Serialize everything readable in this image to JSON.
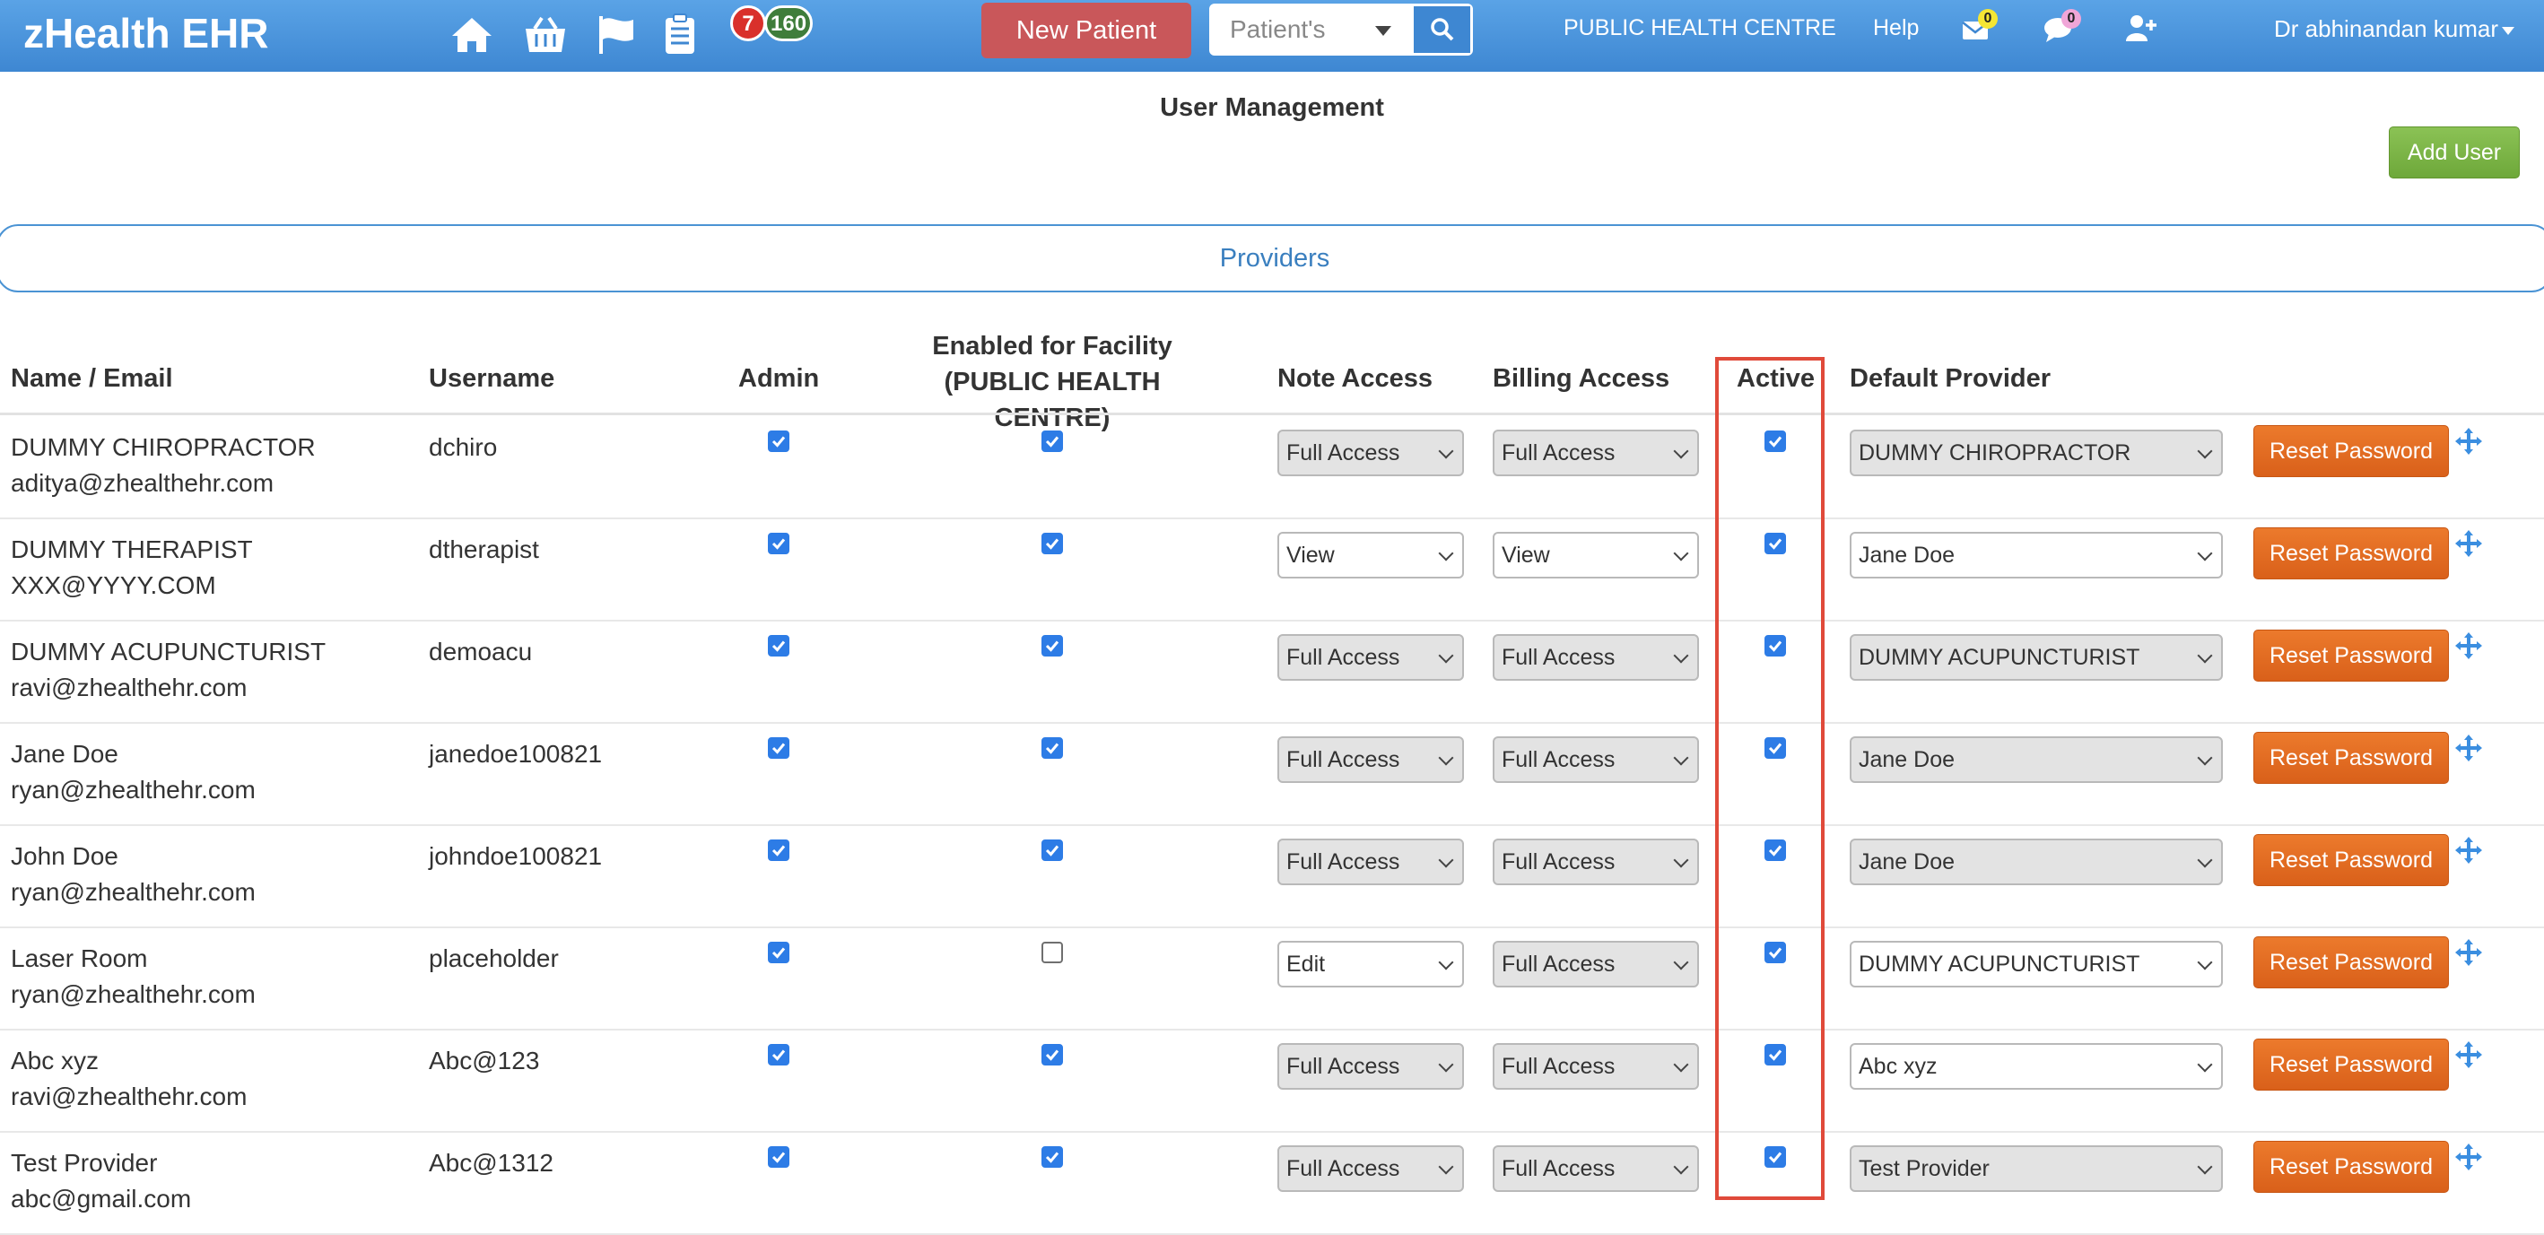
{
  "navbar": {
    "brand": "zHealth EHR",
    "icons": [
      "home-icon",
      "basket-icon",
      "flag-icon",
      "clipboard-icon"
    ],
    "badge_red": "7",
    "badge_green": "160",
    "new_patient_label": "New Patient",
    "search_select_value": "Patient's",
    "facility": "PUBLIC HEALTH CENTRE",
    "help": "Help",
    "mail_count": "0",
    "chat_count": "0",
    "user_name": "Dr abhinandan kumar"
  },
  "page": {
    "title": "User Management",
    "add_user_label": "Add User",
    "tab_label": "Providers"
  },
  "table": {
    "headers": {
      "name": "Name / Email",
      "username": "Username",
      "admin": "Admin",
      "facility_line1": "Enabled for Facility",
      "facility_line2": "(PUBLIC HEALTH CENTRE)",
      "note": "Note Access",
      "billing": "Billing Access",
      "active": "Active",
      "default_provider": "Default Provider"
    },
    "reset_label": "Reset Password",
    "rows": [
      {
        "name": "DUMMY CHIROPRACTOR",
        "email": "aditya@zhealthehr.com",
        "username": "dchiro",
        "admin": true,
        "facility": true,
        "note": "Full Access",
        "billing": "Full Access",
        "active": true,
        "provider": "DUMMY CHIROPRACTOR"
      },
      {
        "name": "DUMMY THERAPIST",
        "email": "XXX@YYYY.COM",
        "username": "dtherapist",
        "admin": true,
        "facility": true,
        "note": "View",
        "billing": "View",
        "active": true,
        "provider": "Jane Doe"
      },
      {
        "name": "DUMMY ACUPUNCTURIST",
        "email": "ravi@zhealthehr.com",
        "username": "demoacu",
        "admin": true,
        "facility": true,
        "note": "Full Access",
        "billing": "Full Access",
        "active": true,
        "provider": "DUMMY ACUPUNCTURIST"
      },
      {
        "name": "Jane Doe",
        "email": "ryan@zhealthehr.com",
        "username": "janedoe100821",
        "admin": true,
        "facility": true,
        "note": "Full Access",
        "billing": "Full Access",
        "active": true,
        "provider": "Jane Doe"
      },
      {
        "name": "John Doe",
        "email": "ryan@zhealthehr.com",
        "username": "johndoe100821",
        "admin": true,
        "facility": true,
        "note": "Full Access",
        "billing": "Full Access",
        "active": true,
        "provider": "Jane Doe"
      },
      {
        "name": "Laser Room",
        "email": "ryan@zhealthehr.com",
        "username": "placeholder",
        "admin": true,
        "facility": false,
        "note": "Edit",
        "billing": "Full Access",
        "active": true,
        "provider": "DUMMY ACUPUNCTURIST"
      },
      {
        "name": "Abc xyz",
        "email": "ravi@zhealthehr.com",
        "username": "Abc@123",
        "admin": true,
        "facility": true,
        "note": "Full Access",
        "billing": "Full Access",
        "active": true,
        "provider": "Abc xyz"
      },
      {
        "name": "Test Provider",
        "email": "abc@gmail.com",
        "username": "Abc@1312",
        "admin": true,
        "facility": true,
        "note": "Full Access",
        "billing": "Full Access",
        "active": true,
        "provider": "Test Provider"
      }
    ]
  },
  "colors": {
    "navbar": "#4a94db",
    "new_patient": "#c9575a",
    "add_user": "#7cb548",
    "reset": "#e26b22",
    "checkbox": "#2d7ce6",
    "highlight": "#e04a3a"
  }
}
